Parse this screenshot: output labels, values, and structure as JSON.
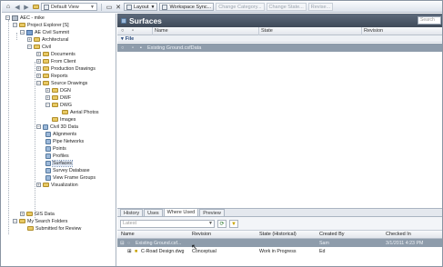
{
  "toolbar": {
    "view_combo": "Default View",
    "layout_label": "Layout",
    "workspace_sync": "Workspace Sync...",
    "faded_tabs": [
      "Change Category...",
      "Change State...",
      "Revise..."
    ]
  },
  "tree": {
    "root": "AEC - mike",
    "project_explorer": "Project Explorer [S]",
    "ae_civil": "AE Civil Summit",
    "architectural": "Architectural",
    "civil": "Civil",
    "documents": "Documents",
    "from_client": "From Client",
    "production_drawings": "Production Drawings",
    "reports": "Reports",
    "source_drawings": "Source Drawings",
    "dgn": "DGN",
    "dwf": "DWF",
    "dwg": "DWG",
    "aerial_photos": "Aerial Photos",
    "images": "Images",
    "civil3d": "Civil 3D Data",
    "alignments": "Alignments",
    "pipe_networks": "Pipe Networks",
    "points": "Points",
    "profiles": "Profiles",
    "surfaces": "Surfaces",
    "survey_db": "Survey Database",
    "view_frame": "View Frame Groups",
    "visualization": "Visualization",
    "gis_data": "GIS Data",
    "search_folders": "My Search Folders",
    "submitted": "Submitted for Review"
  },
  "main": {
    "title": "Surfaces",
    "search_placeholder": "Search",
    "col_name": "Name",
    "col_state": "State",
    "col_revision": "Revision",
    "group": "File",
    "row_name": "Existing Ground.csfData"
  },
  "bottom": {
    "tabs": [
      "History",
      "Uses",
      "Where Used",
      "Preview"
    ],
    "active_tab": "Where Used",
    "filter_value": "Latest",
    "cols": {
      "name": "Name",
      "revision": "Revision",
      "state": "State (Historical)",
      "created_by": "Created By",
      "checked_in": "Checked In"
    },
    "rows": [
      {
        "name": "Existing Ground.csf...",
        "revision": "",
        "state": "",
        "created_by": "Sam",
        "checked_in": "3/1/2011 4:23 PM"
      },
      {
        "name": "C-Road Design.dwg",
        "revision": "Conceptual",
        "state": "Work in Progress",
        "created_by": "Ed",
        "checked_in": ""
      }
    ]
  }
}
